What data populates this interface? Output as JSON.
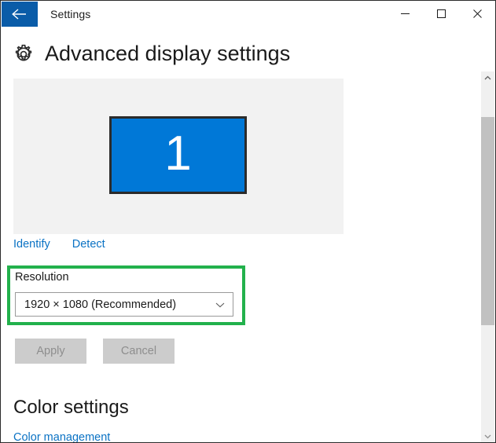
{
  "titlebar": {
    "app_title": "Settings",
    "back_icon": "back-arrow-icon",
    "minimize_label": "—",
    "maximize_label": "☐",
    "close_label": "✕"
  },
  "header": {
    "icon": "gear-icon",
    "title": "Advanced display settings"
  },
  "display_preview": {
    "monitor_number": "1",
    "monitor_color": "#0078d7",
    "panel_color": "#f2f2f2"
  },
  "links": [
    {
      "label": "Identify",
      "name": "identify-link"
    },
    {
      "label": "Detect",
      "name": "detect-link"
    }
  ],
  "resolution": {
    "label": "Resolution",
    "selected_value": "1920 × 1080 (Recommended)",
    "chevron_icon": "chevron-down-icon",
    "highlight_color": "#22b14c"
  },
  "actions": {
    "apply_label": "Apply",
    "cancel_label": "Cancel",
    "disabled": true
  },
  "color_settings": {
    "title": "Color settings",
    "management_link": "Color management"
  },
  "scrollbar": {
    "up_icon": "chevron-up-icon",
    "down_icon": "chevron-down-icon"
  },
  "colors": {
    "accent": "#0078d7",
    "titlebar_back": "#0a5ca8",
    "link": "#0a72c4",
    "highlight": "#22b14c",
    "disabled_button": "#cccccc"
  }
}
